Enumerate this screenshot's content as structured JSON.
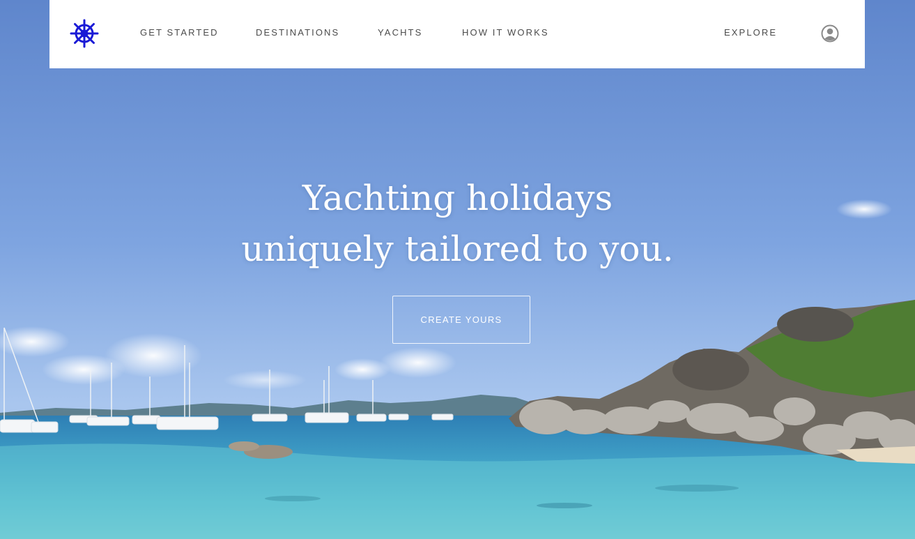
{
  "nav": {
    "logo_icon": "ship-wheel-icon",
    "logo_color": "#1a1ad6",
    "items": [
      {
        "label": "GET STARTED"
      },
      {
        "label": "DESTINATIONS"
      },
      {
        "label": "YACHTS"
      },
      {
        "label": "HOW IT WORKS"
      }
    ],
    "explore_label": "EXPLORE",
    "account_icon": "user-circle-icon"
  },
  "hero": {
    "headline_line1": "Yachting holidays",
    "headline_line2": "uniquely tailored to you.",
    "cta_label": "CREATE YOURS"
  }
}
